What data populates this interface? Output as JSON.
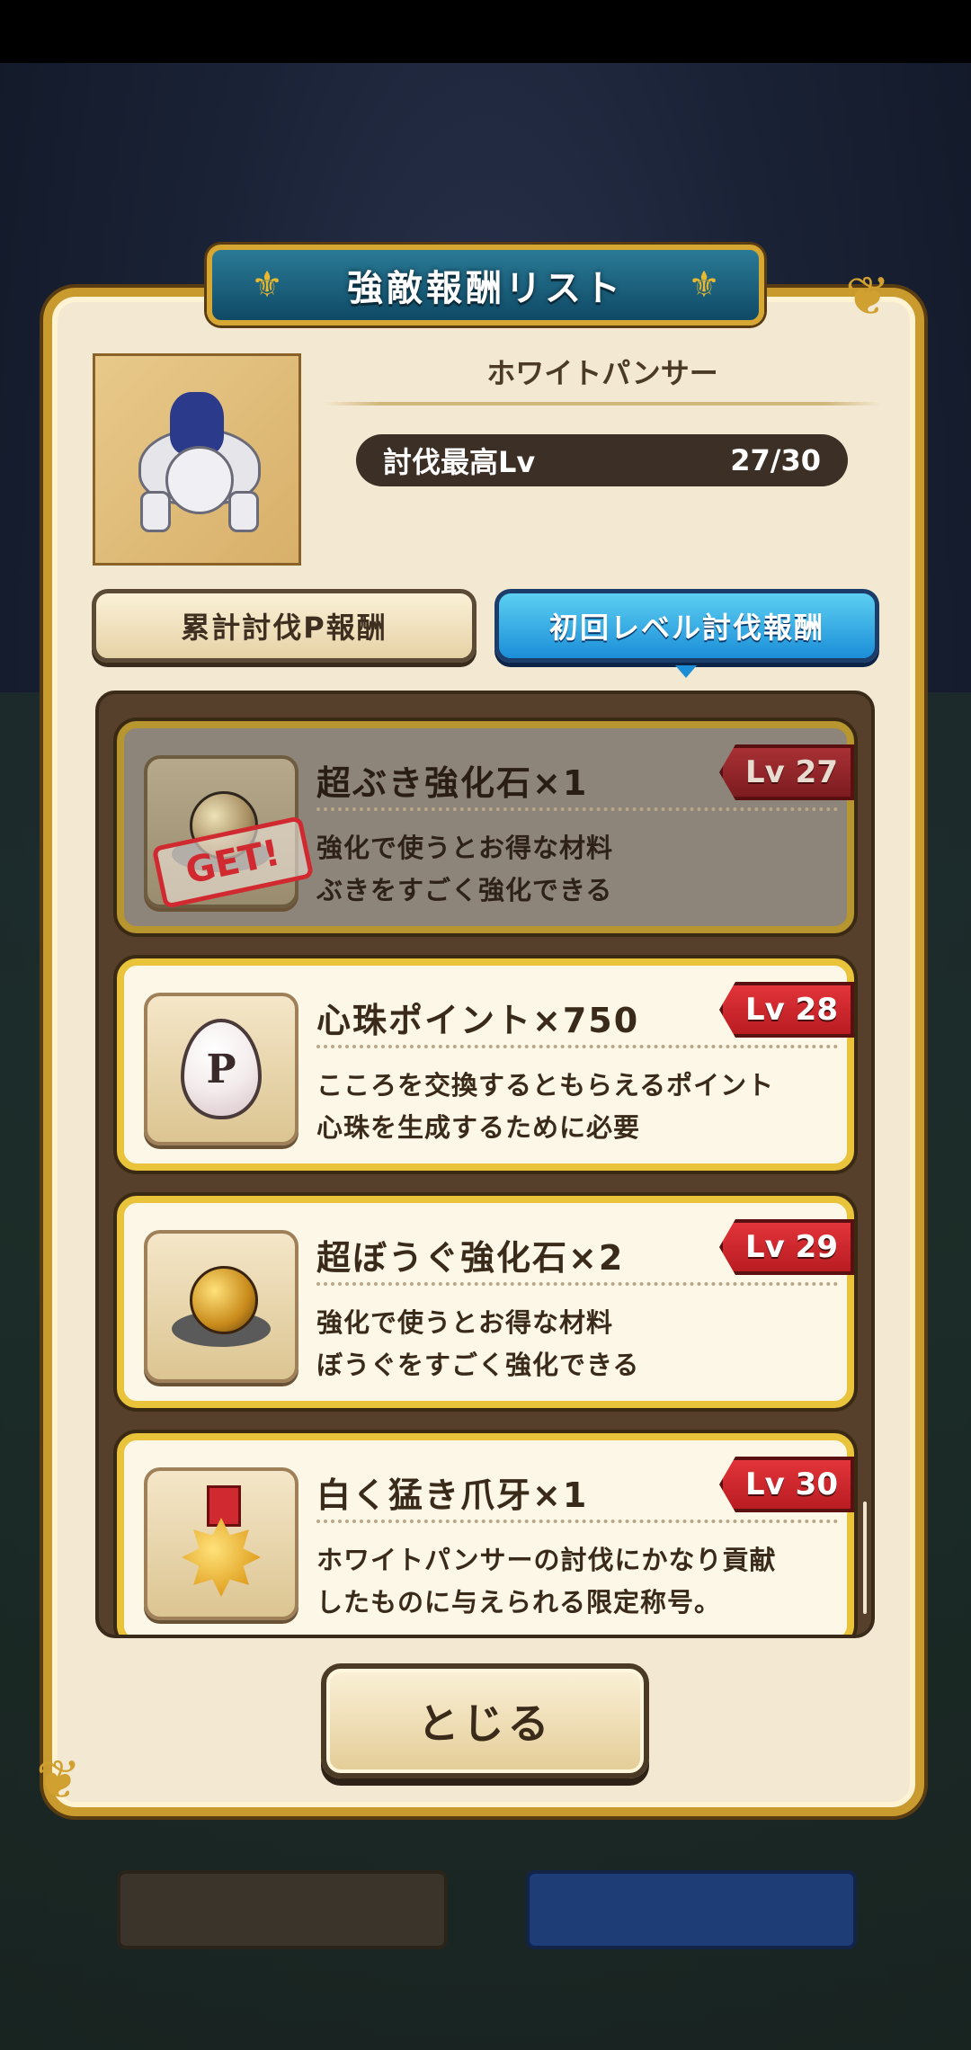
{
  "dialog": {
    "title": "強敵報酬リスト",
    "monster_name": "ホワイトパンサー",
    "defeat_level_label": "討伐最高Lv",
    "defeat_level_value": "27/30"
  },
  "tabs": [
    {
      "label": "累計討伐P報酬",
      "active": false
    },
    {
      "label": "初回レベル討伐報酬",
      "active": true
    }
  ],
  "rewards": [
    {
      "title": "超ぶき強化石×1",
      "desc1": "強化で使うとお得な材料",
      "desc2": "ぶきをすごく強化できる",
      "level": "Lv 27",
      "claimed": true,
      "stamp": "GET!",
      "icon": "weapon-upgrade-stone-icon"
    },
    {
      "title": "心珠ポイント×750",
      "desc1": "こころを交換するともらえるポイント",
      "desc2": "心珠を生成するために必要",
      "level": "Lv 28",
      "claimed": false,
      "icon_text": "P",
      "icon": "heart-orb-point-icon"
    },
    {
      "title": "超ぼうぐ強化石×2",
      "desc1": "強化で使うとお得な材料",
      "desc2": "ぼうぐをすごく強化できる",
      "level": "Lv 29",
      "claimed": false,
      "icon": "armor-upgrade-stone-icon"
    },
    {
      "title": "白く猛き爪牙×1",
      "desc1": "ホワイトパンサーの討伐にかなり貢献",
      "desc2": "したものに与えられる限定称号。",
      "level": "Lv 30",
      "claimed": false,
      "icon": "title-medal-icon"
    }
  ],
  "close_button": "とじる",
  "colors": {
    "panel_bg": "#f3e9d2",
    "gold_border": "#c99a2e",
    "active_tab": "#1b8ed8",
    "level_tag": "#d02a30",
    "list_bg": "#56402c"
  }
}
